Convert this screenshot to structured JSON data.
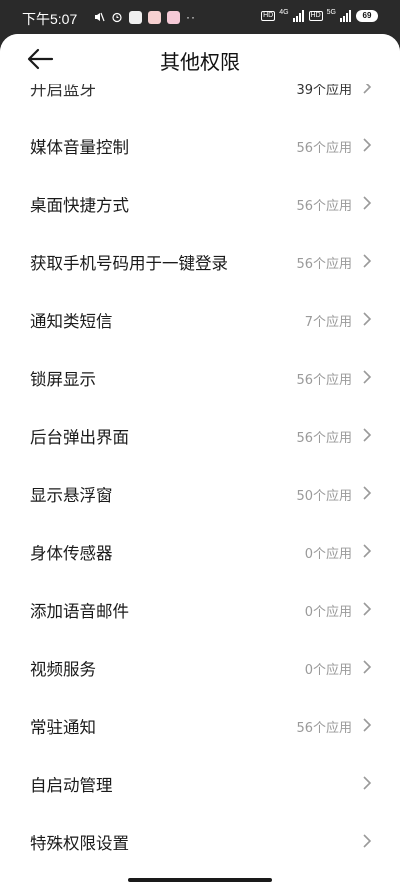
{
  "status": {
    "time": "下午5:07",
    "net1": "4G",
    "net2": "5G",
    "battery": "69",
    "hd1": "HD",
    "hd2": "HD",
    "dots": "··"
  },
  "header": {
    "title": "其他权限"
  },
  "items": [
    {
      "label": "开启蓝牙",
      "count": "39个应用"
    },
    {
      "label": "媒体音量控制",
      "count": "56个应用"
    },
    {
      "label": "桌面快捷方式",
      "count": "56个应用"
    },
    {
      "label": "获取手机号码用于一键登录",
      "count": "56个应用"
    },
    {
      "label": "通知类短信",
      "count": "7个应用"
    },
    {
      "label": "锁屏显示",
      "count": "56个应用"
    },
    {
      "label": "后台弹出界面",
      "count": "56个应用"
    },
    {
      "label": "显示悬浮窗",
      "count": "50个应用"
    },
    {
      "label": "身体传感器",
      "count": "0个应用"
    },
    {
      "label": "添加语音邮件",
      "count": "0个应用"
    },
    {
      "label": "视频服务",
      "count": "0个应用"
    },
    {
      "label": "常驻通知",
      "count": "56个应用"
    },
    {
      "label": "自启动管理",
      "count": ""
    },
    {
      "label": "特殊权限设置",
      "count": ""
    }
  ]
}
